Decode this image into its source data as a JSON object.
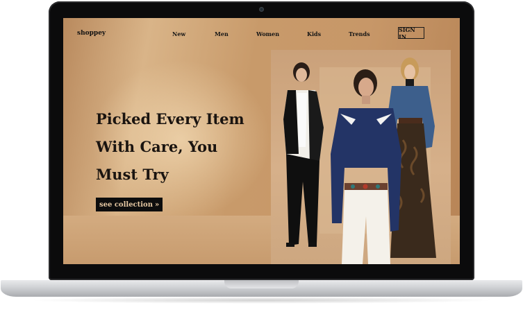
{
  "site": {
    "logo": "shoppey"
  },
  "nav": {
    "items": [
      {
        "label": "New"
      },
      {
        "label": "Men"
      },
      {
        "label": "Women"
      },
      {
        "label": "Kids"
      },
      {
        "label": "Trends"
      }
    ],
    "signin_label": "SIGN IN"
  },
  "hero": {
    "headline_lines": [
      "Picked Every Item",
      "With Care, You",
      "Must Try"
    ],
    "cta_label": "see collection",
    "cta_icon": "double-chevron-right-icon"
  },
  "colors": {
    "background_tan": "#c79768",
    "text_dark": "#1a1410",
    "cta_bg": "#0d0d0d",
    "cta_text": "#e7c9a3"
  }
}
